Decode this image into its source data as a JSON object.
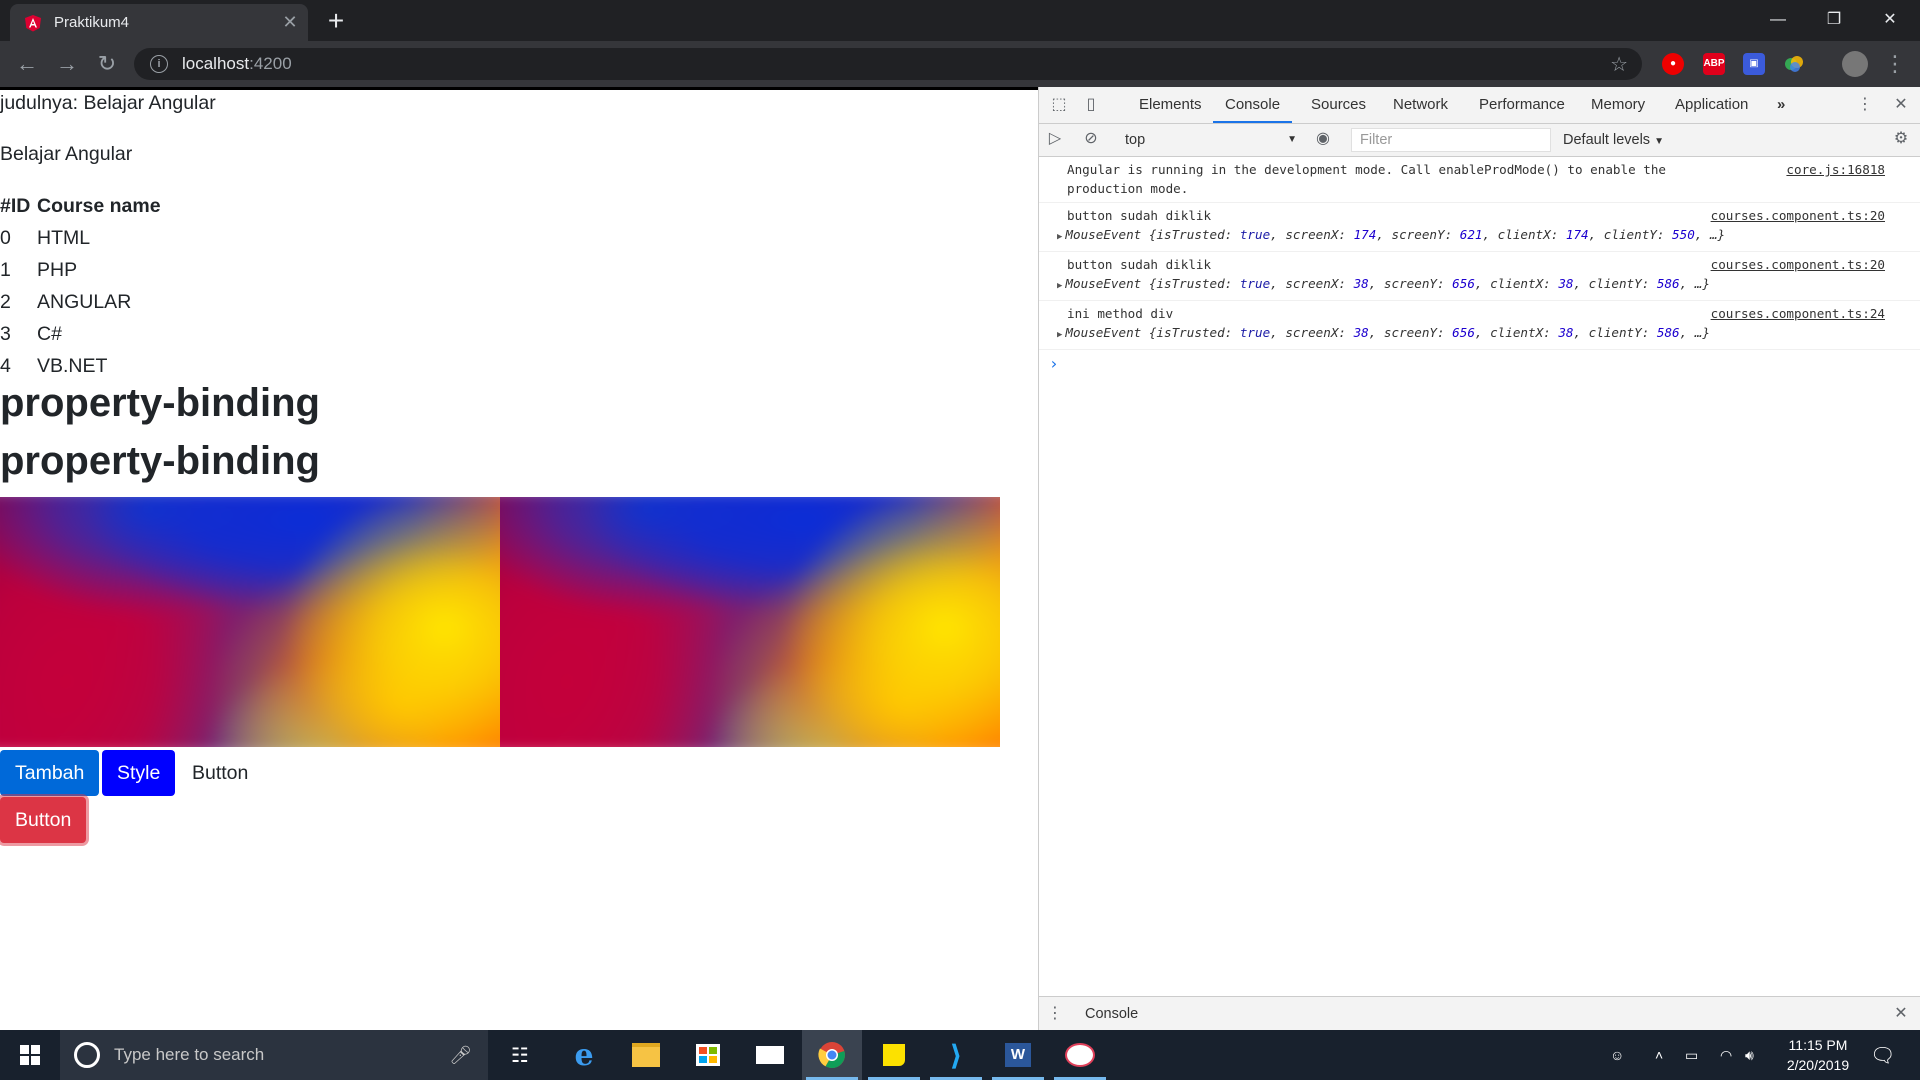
{
  "browser": {
    "tab_title": "Praktikum4",
    "url_host": "localhost",
    "url_port": ":4200",
    "extensions": [
      "shield-extension",
      "ABP",
      "window-extension",
      "colorful-extension"
    ],
    "new_tab_glyph": "+",
    "close_glyph": "✕"
  },
  "page": {
    "subtitle": "judulnya: Belajar Angular",
    "title": "Belajar Angular",
    "table": {
      "headers": [
        "#ID",
        "Course name"
      ],
      "rows": [
        [
          "0",
          "HTML"
        ],
        [
          "1",
          "PHP"
        ],
        [
          "2",
          "ANGULAR"
        ],
        [
          "3",
          "C#"
        ],
        [
          "4",
          "VB.NET"
        ]
      ]
    },
    "heading_1": "property-binding",
    "heading_2": "property-binding",
    "buttons": {
      "tambah": "Tambah",
      "style": "Style",
      "plain": "Button",
      "danger": "Button"
    },
    "colors": {
      "primary": "#0069d9",
      "style": "#0000ff",
      "danger": "#dc3545"
    }
  },
  "devtools": {
    "tabs": [
      "Elements",
      "Console",
      "Sources",
      "Network",
      "Performance",
      "Memory",
      "Application"
    ],
    "active_tab": "Console",
    "more_tabs": "»",
    "context": "top",
    "filter_placeholder": "Filter",
    "levels": "Default levels",
    "messages": [
      {
        "text": "Angular is running in the development mode. Call enableProdMode() to enable the",
        "text2": "production mode.",
        "source": "core.js:16818"
      },
      {
        "text": "button sudah diklik",
        "source": "courses.component.ts:20",
        "obj": {
          "isTrusted": "true",
          "screenX": "174",
          "screenY": "621",
          "clientX": "174",
          "clientY": "550"
        }
      },
      {
        "text": "button sudah diklik",
        "source": "courses.component.ts:20",
        "obj": {
          "isTrusted": "true",
          "screenX": "38",
          "screenY": "656",
          "clientX": "38",
          "clientY": "586"
        }
      },
      {
        "text": "ini method div",
        "source": "courses.component.ts:24",
        "obj": {
          "isTrusted": "true",
          "screenX": "38",
          "screenY": "656",
          "clientX": "38",
          "clientY": "586"
        }
      }
    ],
    "obj_prefix": "MouseEvent",
    "prompt": "›",
    "drawer_title": "Console"
  },
  "taskbar": {
    "search_placeholder": "Type here to search",
    "time": "11:15 PM",
    "date": "2/20/2019",
    "apps": [
      "task-view",
      "edge",
      "file-explorer",
      "store",
      "mail",
      "chrome",
      "sticky-notes",
      "vscode",
      "word",
      "paint"
    ]
  }
}
